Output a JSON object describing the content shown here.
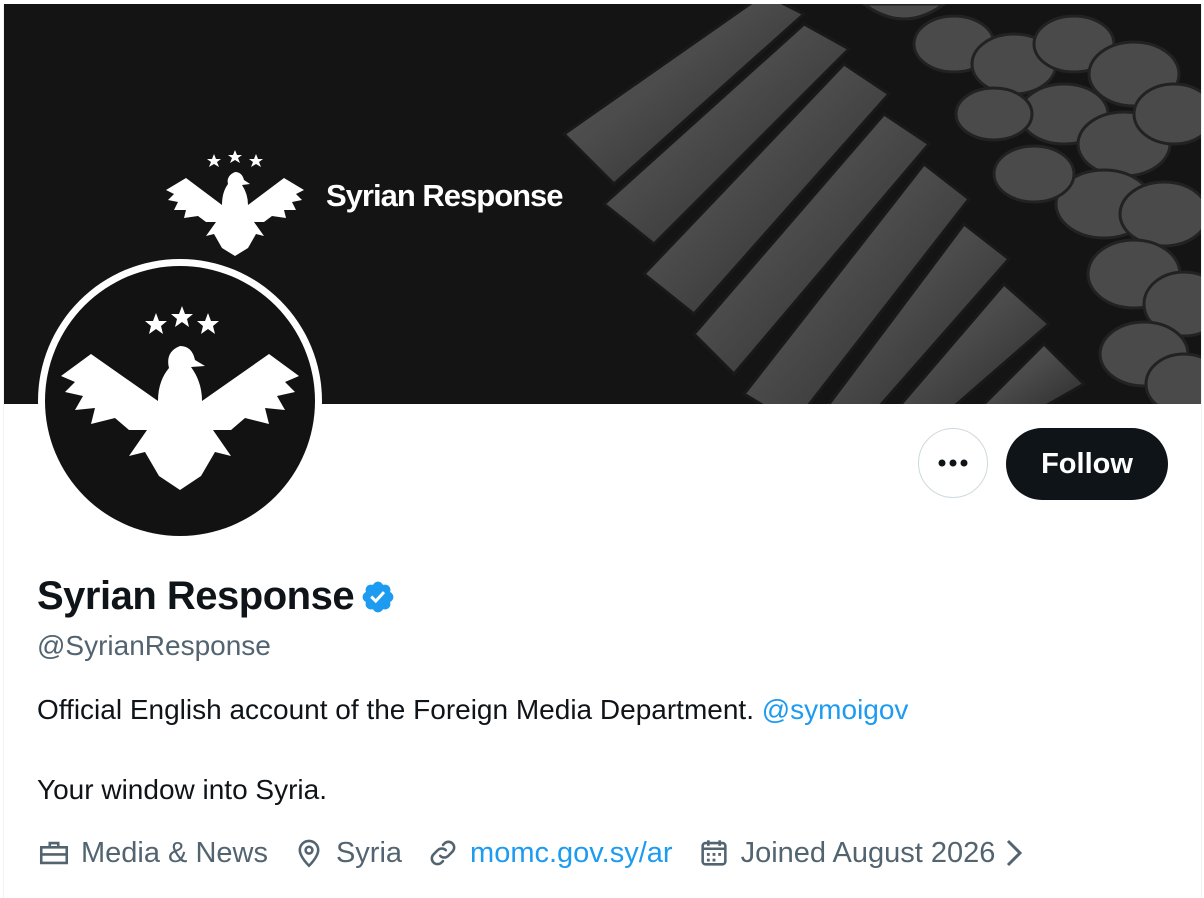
{
  "banner": {
    "title": "Syrian Response",
    "background_color": "#141414"
  },
  "profile": {
    "display_name": "Syrian Response",
    "verified": true,
    "handle": "@SyrianResponse",
    "bio_line1": "Official English account of the Foreign Media Department.",
    "bio_mention": "@symoigov",
    "bio_line2": "Your window into Syria.",
    "category": "Media & News",
    "location": "Syria",
    "website": "momc.gov.sy/ar",
    "joined": "Joined August 2026"
  },
  "actions": {
    "more_icon": "more-dots-icon",
    "follow_label": "Follow"
  },
  "colors": {
    "accent": "#1d9bf0",
    "text_primary": "#0f1419",
    "text_secondary": "#536471",
    "button_dark": "#0f1419"
  }
}
